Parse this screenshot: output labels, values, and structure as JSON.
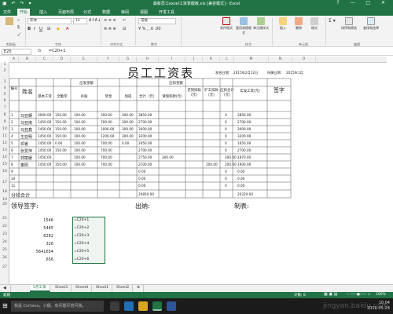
{
  "window": {
    "title": "最新员工excel工资表模板.xls [兼容模式] - Excel",
    "controls": [
      "?",
      "—",
      "□",
      "✕"
    ]
  },
  "ribbon_tabs": [
    "文件",
    "开始",
    "插入",
    "页面布局",
    "公式",
    "数据",
    "审阅",
    "视图",
    "开发工具"
  ],
  "ribbon": {
    "font_name": "宋体",
    "font_size": "12",
    "groups": [
      "剪贴板",
      "字体",
      "对齐方式",
      "数字",
      "样式",
      "单元格",
      "编辑"
    ],
    "format_value": "常规",
    "styles": [
      "条件格式",
      "套用表格格式",
      "单元格样式"
    ],
    "cells": [
      "插入",
      "删除",
      "格式"
    ],
    "editing": [
      "排序和筛选",
      "查找和选择"
    ]
  },
  "formula_bar": {
    "name_box": "E20",
    "fx": "fx",
    "formula": "=C20+1"
  },
  "columns": [
    "A",
    "B",
    "C",
    "D",
    "E",
    "F",
    "G",
    "H",
    "I",
    "J",
    "K",
    "L",
    "M",
    "N",
    "O"
  ],
  "rows": [
    "1",
    "2",
    "3",
    "4",
    "5",
    "6",
    "7",
    "8",
    "9",
    "10",
    "11",
    "12",
    "13",
    "14",
    "15",
    "16",
    "17",
    "18",
    "19",
    "20",
    "21",
    "22",
    "23",
    "24",
    "25",
    "26",
    "27"
  ],
  "sheet": {
    "title": "员工工资表",
    "issue_date_label": "发放日期：",
    "issue_date": "2015年2月12日",
    "belong_month_label": "所属日期：",
    "belong_month": "2015年1月",
    "headers": {
      "num": "编号",
      "name": "姓名",
      "payable": "应发金额",
      "deduct": "应扣金额",
      "actual": "实发工资(元)",
      "sign": "签字",
      "base": "基本工资",
      "allowance": "全勤奖",
      "subsidy": "补贴",
      "bonus": "奖金",
      "overtime": "加班",
      "total": "合计（元）",
      "leave": "请假扣款(元)",
      "late": "迟到扣款(元)",
      "absent": "旷工扣款(元)",
      "deduct_total": "应扣合计(元)"
    },
    "employees": [
      {
        "no": "1",
        "name": "马亚朝",
        "base": "3000.00",
        "allowance": "150.00",
        "subsidy": "100.00",
        "bonus": "300.00",
        "overtime": "300.00",
        "total": "3850.00",
        "leave": "",
        "late": "",
        "absent": "",
        "deduct": "0",
        "actual": "3850.00"
      },
      {
        "no": "2",
        "name": "马亚南",
        "base": "1450.00",
        "allowance": "150.00",
        "subsidy": "100.00",
        "bonus": "700.00",
        "overtime": "300.00",
        "total": "2700.00",
        "leave": "",
        "late": "",
        "absent": "",
        "deduct": "0",
        "actual": "2700.00"
      },
      {
        "no": "3",
        "name": "马亚鑫",
        "base": "1450.00",
        "allowance": "150.00",
        "subsidy": "100.00",
        "bonus": "1000.00",
        "overtime": "300.00",
        "total": "3000.00",
        "leave": "",
        "late": "",
        "absent": "",
        "deduct": "0",
        "actual": "3000.00"
      },
      {
        "no": "4",
        "name": "王亚明",
        "base": "1450.00",
        "allowance": "150.00",
        "subsidy": "100.00",
        "bonus": "1200.00",
        "overtime": "300.00",
        "total": "3200.00",
        "leave": "",
        "late": "",
        "absent": "",
        "deduct": "0",
        "actual": "3200.00"
      },
      {
        "no": "5",
        "name": "邓睿",
        "base": "1450.00",
        "allowance": "0.00",
        "subsidy": "100.00",
        "bonus": "700.00",
        "overtime": "0.00",
        "total": "2650.00",
        "leave": "",
        "late": "",
        "absent": "",
        "deduct": "0",
        "actual": "1650.00"
      },
      {
        "no": "6",
        "name": "张爱萍",
        "base": "1450.00",
        "allowance": "150.00",
        "subsidy": "100.00",
        "bonus": "700.00",
        "overtime": "",
        "total": "2700.00",
        "leave": "",
        "late": "",
        "absent": "",
        "deduct": "0",
        "actual": "2700.00"
      },
      {
        "no": "7",
        "name": "郭丽媛",
        "base": "1450.00",
        "allowance": "",
        "subsidy": "100.00",
        "bonus": "700.00",
        "overtime": "",
        "total": "2750.00",
        "leave": "300.00",
        "late": "",
        "absent": "",
        "deduct": "300.00",
        "actual": "1870.00"
      },
      {
        "no": "8",
        "name": "秦阳",
        "base": "1450.00",
        "allowance": "150.00",
        "subsidy": "100.00",
        "bonus": "700.00",
        "overtime": "",
        "total": "2100.00",
        "leave": "",
        "late": "",
        "absent": "200.00",
        "deduct": "200.00",
        "actual": "1900.00"
      },
      {
        "no": "9",
        "name": "",
        "base": "",
        "allowance": "",
        "subsidy": "",
        "bonus": "",
        "overtime": "",
        "total": "0.00",
        "leave": "",
        "late": "",
        "absent": "",
        "deduct": "0",
        "actual": "0.00"
      },
      {
        "no": "10",
        "name": "",
        "base": "",
        "allowance": "",
        "subsidy": "",
        "bonus": "",
        "overtime": "",
        "total": "0.00",
        "leave": "",
        "late": "",
        "absent": "",
        "deduct": "0",
        "actual": "0.00"
      },
      {
        "no": "11",
        "name": "",
        "base": "",
        "allowance": "",
        "subsidy": "",
        "bonus": "",
        "overtime": "",
        "total": "0.00",
        "leave": "",
        "late": "",
        "absent": "",
        "deduct": "0",
        "actual": "0.00"
      }
    ],
    "subtotal_label": "分栏合计",
    "subtotal_total": "20850.00",
    "subtotal_actual": "20320.00",
    "leader_label": "领导签字:",
    "cashier_label": "出纳:",
    "maker_label": "制表:",
    "numbers": [
      "1546",
      "5465",
      "6262",
      "326",
      "5641654",
      "656"
    ],
    "formulas": [
      "=C20+1",
      "=C20+2",
      "=C20+3",
      "=C20+4",
      "=C20+5",
      "=C20+6"
    ]
  },
  "sheet_tabs": [
    "5月工资",
    "Sheet3",
    "Sheet4",
    "Sheet1",
    "Sheet2"
  ],
  "status": {
    "left": "就绪",
    "count": "计数: 6",
    "zoom": "100%"
  },
  "taskbar": {
    "search": "我是 Cortana，小娜。有问题尽管问我。",
    "time": "10:04",
    "date": "2016-05-24"
  },
  "watermark": "jingyan.baidu.com",
  "colors": {
    "accent": "#217346",
    "taskbar": "#1b1b1b"
  }
}
